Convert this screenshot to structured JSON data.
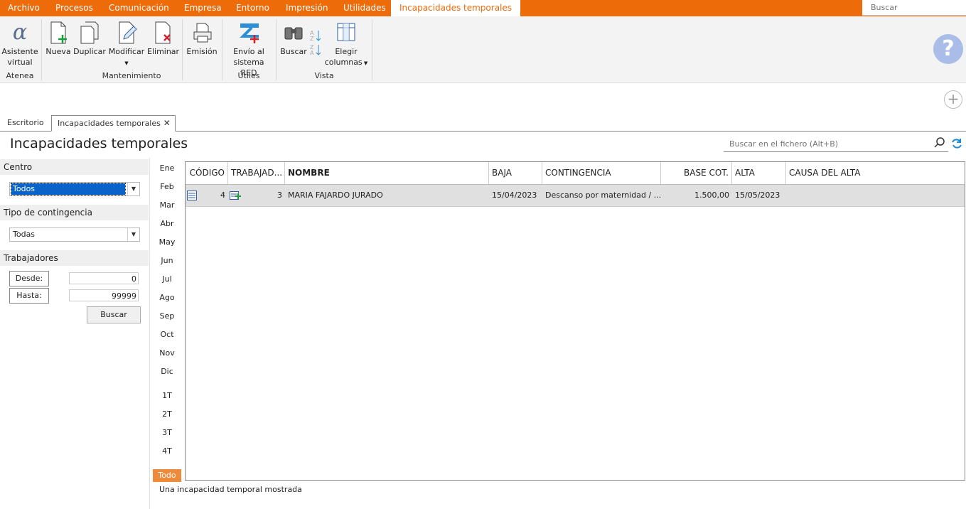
{
  "menubar": {
    "items": [
      "Archivo",
      "Procesos",
      "Comunicación",
      "Empresa",
      "Entorno",
      "Impresión",
      "Utilidades"
    ],
    "context_tab": "Incapacidades temporales",
    "search_placeholder": "Buscar"
  },
  "ribbon": {
    "groups": [
      "Atenea",
      "Mantenimiento",
      "Útiles",
      "Vista"
    ],
    "asistente": [
      "Asistente",
      "virtual"
    ],
    "nueva": "Nueva",
    "duplicar": "Duplicar",
    "modificar": "Modificar",
    "eliminar": "Eliminar",
    "emision": "Emisión",
    "envio": [
      "Envío al",
      "sistema RED"
    ],
    "buscar": "Buscar",
    "elegir": [
      "Elegir",
      "columnas"
    ]
  },
  "tabs": {
    "escritorio": "Escritorio",
    "active": "Incapacidades temporales"
  },
  "page": {
    "title": "Incapacidades temporales",
    "search_placeholder": "Buscar en el fichero (Alt+B)"
  },
  "filters": {
    "centro_label": "Centro",
    "centro_value": "Todos",
    "contingencia_label": "Tipo de contingencia",
    "contingencia_value": "Todas",
    "trabajadores_label": "Trabajadores",
    "desde_label": "Desde:",
    "desde_value": "0",
    "hasta_label": "Hasta:",
    "hasta_value": "99999",
    "buscar_button": "Buscar"
  },
  "periods": [
    "Ene",
    "Feb",
    "Mar",
    "Abr",
    "May",
    "Jun",
    "Jul",
    "Ago",
    "Sep",
    "Oct",
    "Nov",
    "Dic",
    "1T",
    "2T",
    "3T",
    "4T",
    "Todo"
  ],
  "grid": {
    "headers": [
      "CÓDIGO",
      "TRABAJAD...",
      "NOMBRE",
      "BAJA",
      "CONTINGENCIA",
      "BASE COT.",
      "ALTA",
      "CAUSA DEL ALTA"
    ],
    "rows": [
      {
        "codigo": "4",
        "trabajador": "3",
        "nombre": "MARIA FAJARDO JURADO",
        "baja": "15/04/2023",
        "contingencia": "Descanso por maternidad / ...",
        "base_cot": "1.500,00",
        "alta": "15/05/2023",
        "causa_alta": ""
      }
    ]
  },
  "status": "Una incapacidad temporal mostrada"
}
